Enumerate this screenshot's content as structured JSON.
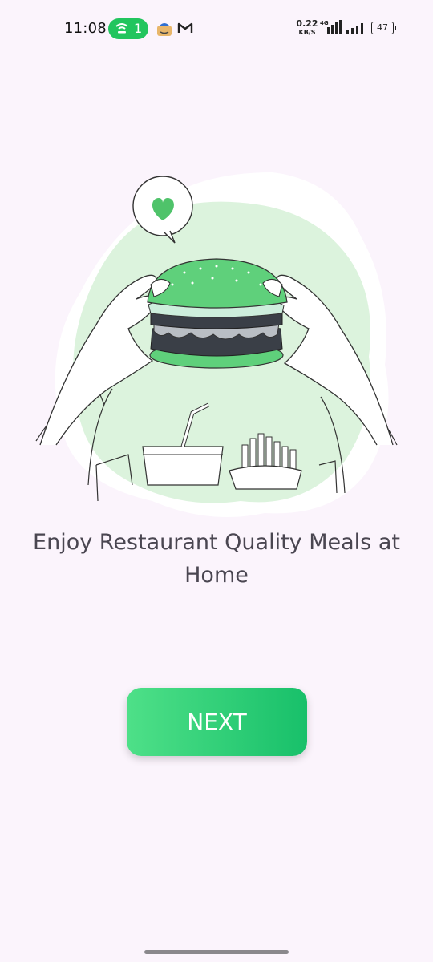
{
  "status_bar": {
    "time": "11:08",
    "hotspot_count": "1",
    "net_speed": "0.22",
    "net_speed_unit": "KB/S",
    "network_type": "4G",
    "battery": "47"
  },
  "onboarding": {
    "headline": "Enjoy Restaurant Quality Meals at Home",
    "next_label": "NEXT"
  },
  "colors": {
    "accent": "#22c55e",
    "background": "#fbf4fc",
    "text": "#4a4651"
  }
}
